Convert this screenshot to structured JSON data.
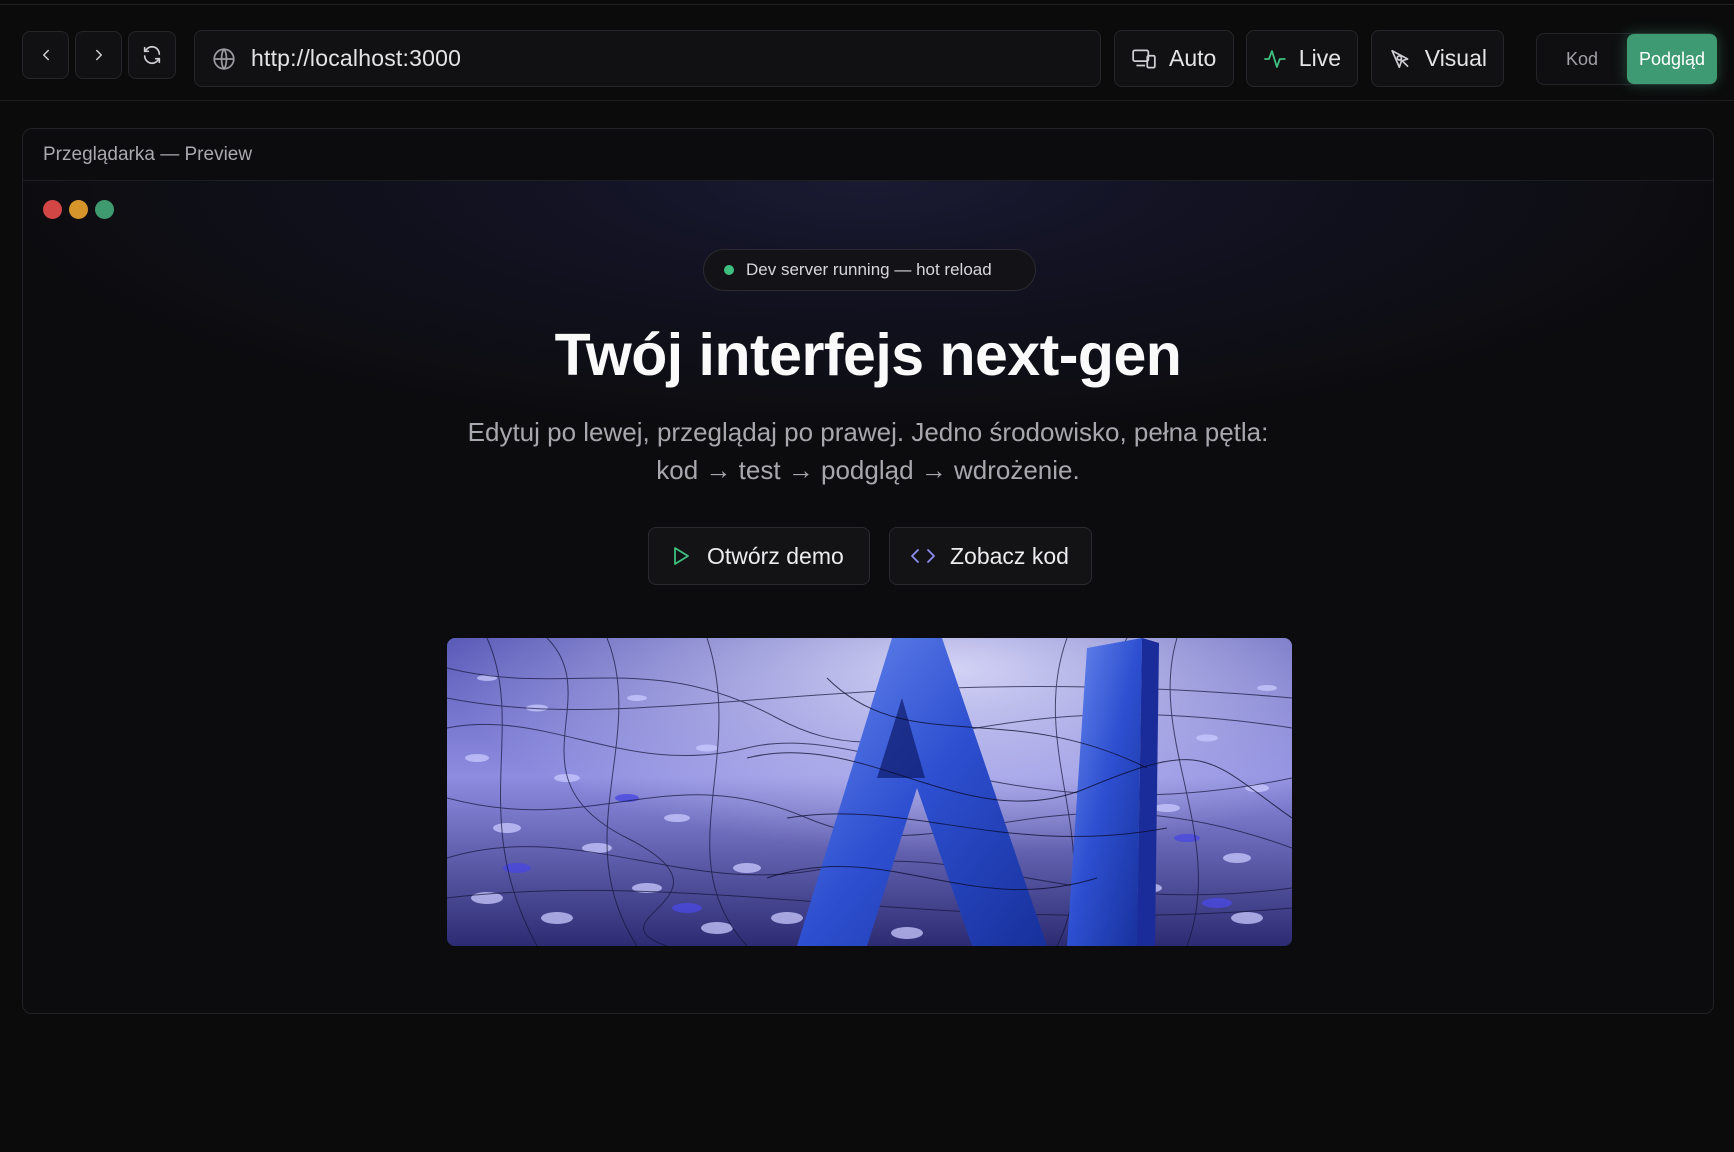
{
  "toolbar": {
    "url": "http://localhost:3000",
    "mode_auto": "Auto",
    "mode_live": "Live",
    "mode_visual": "Visual",
    "view_code": "Kod",
    "view_preview": "Podgląd",
    "accent": "#3e9a72"
  },
  "panel": {
    "title": "Przeglądarka — Preview"
  },
  "page": {
    "badge": "Dev server running — hot reload",
    "heading": "Twój interfejs next-gen",
    "subtitle_line1": "Edytuj po lewej, przeglądaj po prawej. Jedno środowisko, pełna pętla:",
    "subtitle_line2": "kod → test → podgląd → wdrożenie.",
    "btn_demo": "Otwórz demo",
    "btn_code": "Zobacz kod",
    "hero_text": "AI"
  }
}
